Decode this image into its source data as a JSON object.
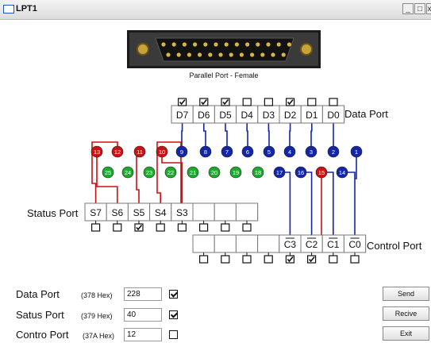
{
  "window": {
    "title": "LPT1",
    "minimize": "_",
    "restore": "□",
    "close": "x"
  },
  "connector": {
    "caption": "Parallel Port - Female"
  },
  "data_port": {
    "label": "Data Port",
    "pins": [
      {
        "name": "D7",
        "checked": true
      },
      {
        "name": "D6",
        "checked": true
      },
      {
        "name": "D5",
        "checked": true
      },
      {
        "name": "D4",
        "checked": false
      },
      {
        "name": "D3",
        "checked": false
      },
      {
        "name": "D2",
        "checked": true
      },
      {
        "name": "D1",
        "checked": false
      },
      {
        "name": "D0",
        "checked": false
      }
    ]
  },
  "status_port": {
    "label": "Status Port",
    "pins": [
      {
        "name": "S7",
        "checked": false
      },
      {
        "name": "S6",
        "checked": false
      },
      {
        "name": "S5",
        "checked": true
      },
      {
        "name": "S4",
        "checked": false
      },
      {
        "name": "S3",
        "checked": false
      },
      {
        "name": "",
        "checked": false
      },
      {
        "name": "",
        "checked": false
      },
      {
        "name": "",
        "checked": false
      }
    ]
  },
  "control_port": {
    "label": "Control Port",
    "pins": [
      {
        "name": "",
        "checked": false
      },
      {
        "name": "",
        "checked": false
      },
      {
        "name": "",
        "checked": false
      },
      {
        "name": "",
        "checked": false
      },
      {
        "name": "C3",
        "checked": true
      },
      {
        "name": "C2",
        "checked": true
      },
      {
        "name": "C1",
        "checked": false
      },
      {
        "name": "C0",
        "checked": false
      }
    ]
  },
  "pins_row1": [
    {
      "num": "13",
      "color": "#cc1111"
    },
    {
      "num": "12",
      "color": "#cc1111"
    },
    {
      "num": "11",
      "color": "#cc1111"
    },
    {
      "num": "10",
      "color": "#cc1111"
    },
    {
      "num": "9",
      "color": "#1326a8"
    },
    {
      "num": "8",
      "color": "#1326a8"
    },
    {
      "num": "7",
      "color": "#1326a8"
    },
    {
      "num": "6",
      "color": "#1326a8"
    },
    {
      "num": "5",
      "color": "#1326a8"
    },
    {
      "num": "4",
      "color": "#1326a8"
    },
    {
      "num": "3",
      "color": "#1326a8"
    },
    {
      "num": "2",
      "color": "#1326a8"
    },
    {
      "num": "1",
      "color": "#1326a8"
    }
  ],
  "pins_row2": [
    {
      "num": "25",
      "color": "#1fa82e"
    },
    {
      "num": "24",
      "color": "#1fa82e"
    },
    {
      "num": "23",
      "color": "#1fa82e"
    },
    {
      "num": "22",
      "color": "#1fa82e"
    },
    {
      "num": "21",
      "color": "#1fa82e"
    },
    {
      "num": "20",
      "color": "#1fa82e"
    },
    {
      "num": "19",
      "color": "#1fa82e"
    },
    {
      "num": "18",
      "color": "#1fa82e"
    },
    {
      "num": "17",
      "color": "#1326a8"
    },
    {
      "num": "16",
      "color": "#1326a8"
    },
    {
      "num": "15",
      "color": "#cc1111"
    },
    {
      "num": "14",
      "color": "#1326a8"
    }
  ],
  "registers": [
    {
      "label": "Data Port",
      "hex": "(378 Hex)",
      "value": "228",
      "checked": true
    },
    {
      "label": "Satus Port",
      "hex": "(379 Hex)",
      "value": "40",
      "checked": true
    },
    {
      "label": "Contro Port",
      "hex": "(37A Hex)",
      "value": "12",
      "checked": false
    }
  ],
  "buttons": {
    "send": "Send",
    "receive": "Recive",
    "exit": "Exit"
  },
  "colors": {
    "wire_blue": "#1326a8",
    "wire_red": "#cc1111",
    "pin_green": "#1fa82e"
  }
}
